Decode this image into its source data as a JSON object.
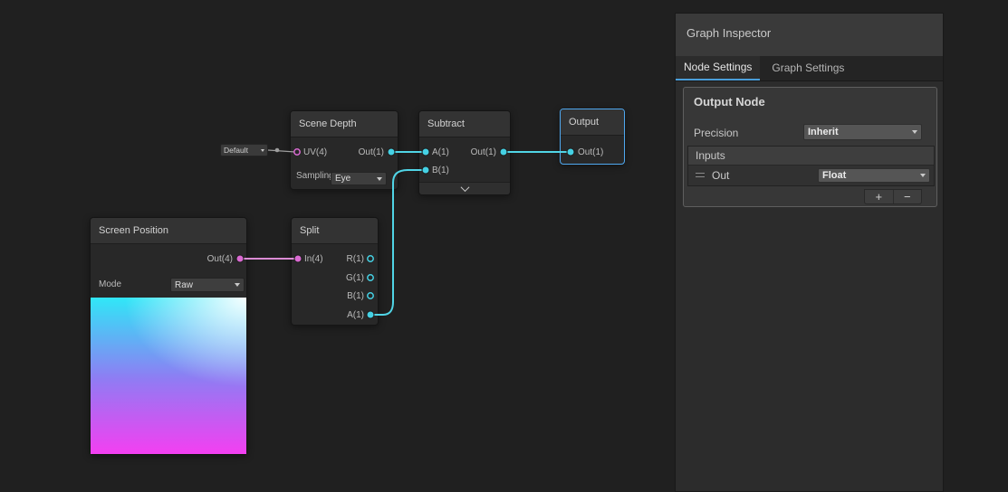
{
  "colors": {
    "accent-blue": "#4a9eda",
    "selected-border": "#4fa8f0",
    "wire-cyan": "#50d5e6",
    "port-cyan": "#45d1e4",
    "wire-pink": "#db8bd4",
    "port-pink": "#da6ad2",
    "wire-gray": "#9e9e9e",
    "preview-top": "#30e7f7",
    "preview-mid": "#8f7cf3",
    "preview-bottom": "#f43ff2"
  },
  "inspector": {
    "title": "Graph Inspector",
    "tabs": {
      "node_settings": "Node Settings",
      "graph_settings": "Graph Settings"
    },
    "output_node": {
      "title": "Output Node",
      "precision_label": "Precision",
      "precision_value": "Inherit",
      "inputs_label": "Inputs",
      "input_name": "Out",
      "input_type": "Float",
      "add_button": "+",
      "remove_button": "−"
    }
  },
  "nodes": {
    "scene_depth": {
      "title": "Scene Depth",
      "uv_label": "UV(4)",
      "out_label": "Out(1)",
      "sampling_label": "Sampling",
      "sampling_value": "Eye",
      "uv_default_value": "Default"
    },
    "subtract": {
      "title": "Subtract",
      "a_label": "A(1)",
      "b_label": "B(1)",
      "out_label": "Out(1)"
    },
    "output": {
      "title": "Output",
      "out_label": "Out(1)"
    },
    "screen_position": {
      "title": "Screen Position",
      "out_label": "Out(4)",
      "mode_label": "Mode",
      "mode_value": "Raw"
    },
    "split": {
      "title": "Split",
      "in_label": "In(4)",
      "r_label": "R(1)",
      "g_label": "G(1)",
      "b_label": "B(1)",
      "a_label": "A(1)"
    }
  }
}
